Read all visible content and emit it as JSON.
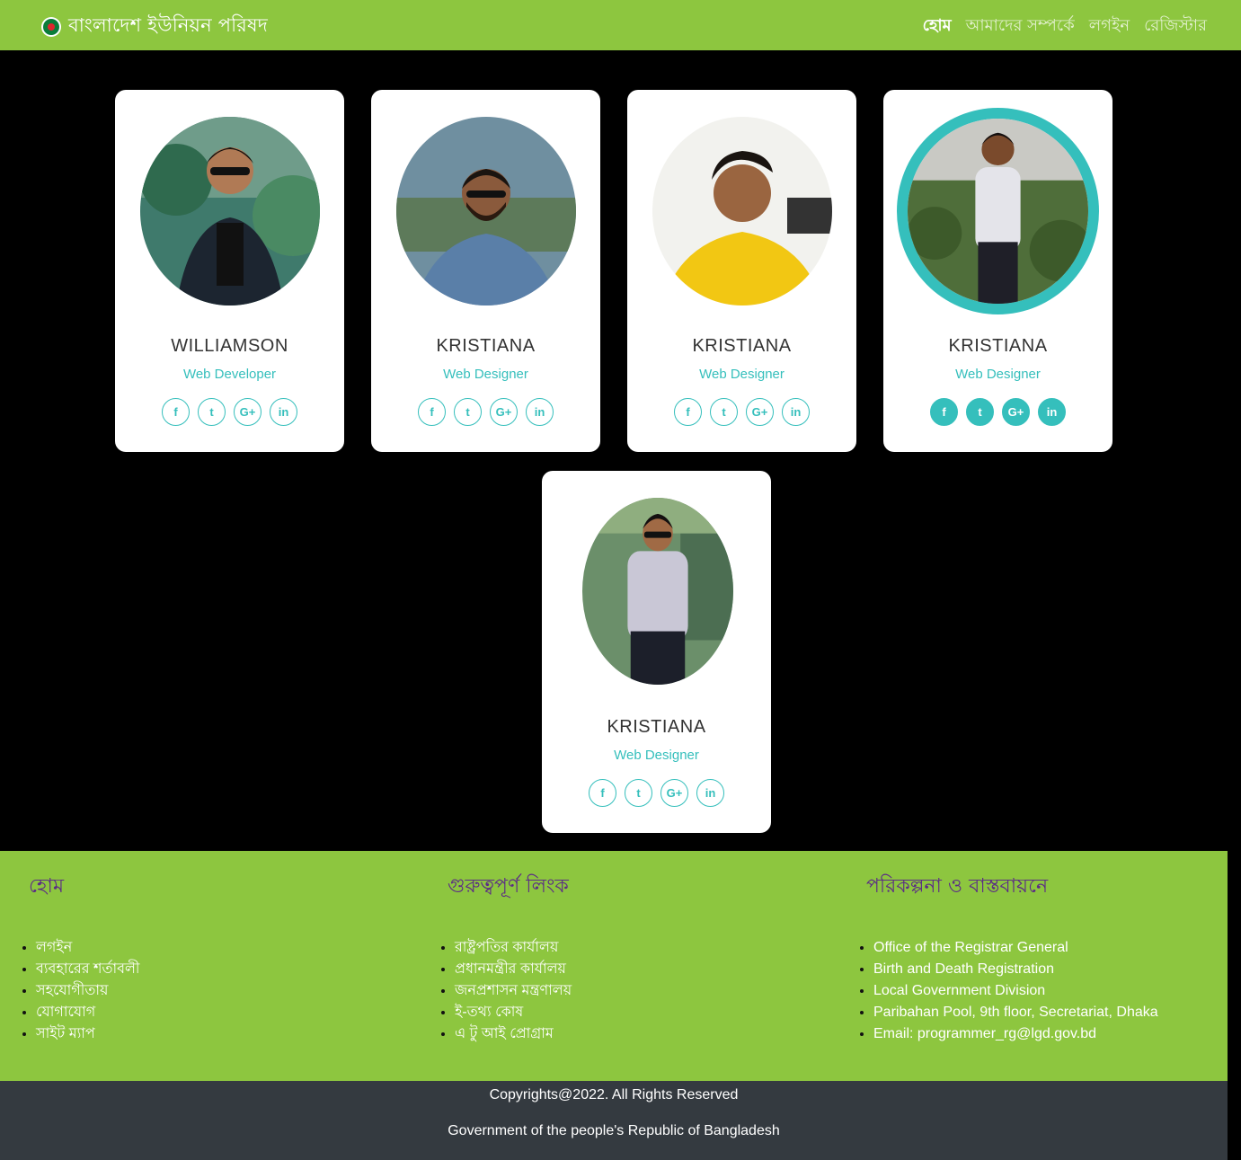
{
  "navbar": {
    "brand": "বাংলাদেশ ইউনিয়ন পরিষদ",
    "links": [
      "হোম",
      "আমাদের সম্পর্কে",
      "লগইন",
      "রেজিস্টার"
    ]
  },
  "team": [
    {
      "name": "WILLIAMSON",
      "role": "Web Developer"
    },
    {
      "name": "KRISTIANA",
      "role": "Web Designer"
    },
    {
      "name": "KRISTIANA",
      "role": "Web Designer"
    },
    {
      "name": "KRISTIANA",
      "role": "Web Designer"
    },
    {
      "name": "KRISTIANA",
      "role": "Web Designer"
    }
  ],
  "social_icons": [
    "facebook-icon",
    "twitter-icon",
    "google-plus-icon",
    "linkedin-icon"
  ],
  "social_glyphs": {
    "facebook": "f",
    "twitter": "t",
    "google": "G+",
    "linkedin": "in"
  },
  "footer": {
    "col1": {
      "title": "হোম",
      "items": [
        "লগইন",
        "ব্যবহারের শর্তাবলী",
        "সহযোগীতায়",
        "যোগাযোগ",
        "সাইট ম্যাপ"
      ]
    },
    "col2": {
      "title": "গুরুত্বপূর্ণ লিংক",
      "items": [
        "রাষ্ট্রপতির কার্যালয়",
        "প্রধানমন্ত্রীর কার্যালয়",
        "জনপ্রশাসন মন্ত্রণালয়",
        "ই-তথ্য কোষ",
        "এ টু আই প্রোগ্রাম"
      ]
    },
    "col3": {
      "title": "পরিকল্পনা ও বাস্তবায়নে",
      "items": [
        "Office of the Registrar General",
        "Birth and Death Registration",
        "Local Government Division",
        "Paribahan Pool, 9th floor, Secretariat, Dhaka",
        "Email: programmer_rg@lgd.gov.bd"
      ]
    }
  },
  "copyright": {
    "line1": "Copyrights@2022. All Rights Reserved",
    "line2": "Government of the people's Republic of Bangladesh"
  },
  "colors": {
    "brand_green": "#8dc63f",
    "accent_teal": "#35bfbc",
    "footer_heading": "#5b2b86",
    "copyright_bg": "#343a40"
  }
}
